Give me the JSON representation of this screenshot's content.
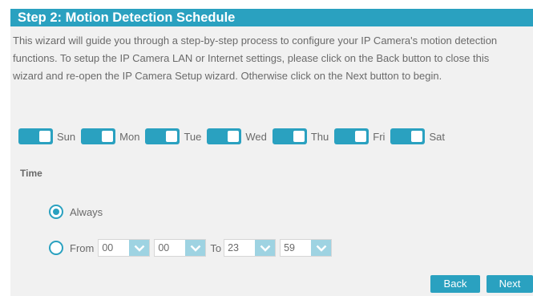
{
  "header": {
    "title": "Step 2: Motion Detection Schedule"
  },
  "intro": {
    "line1": "This wizard will guide you through a step-by-step process to configure your IP Camera's motion detection",
    "line2": "functions. To setup the IP Camera LAN or Internet settings, please click on the Back button to close this",
    "line3": "wizard and re-open the IP Camera Setup wizard. Otherwise click on the Next button to begin."
  },
  "days": [
    {
      "label": "Sun",
      "enabled": true
    },
    {
      "label": "Mon",
      "enabled": true
    },
    {
      "label": "Tue",
      "enabled": true
    },
    {
      "label": "Wed",
      "enabled": true
    },
    {
      "label": "Thu",
      "enabled": true
    },
    {
      "label": "Fri",
      "enabled": true
    },
    {
      "label": "Sat",
      "enabled": true
    }
  ],
  "time": {
    "label": "Time",
    "always_label": "Always",
    "always_selected": true,
    "from_label": "From",
    "to_label": "To",
    "from_hour": "00",
    "from_minute": "00",
    "to_hour": "23",
    "to_minute": "59"
  },
  "buttons": {
    "back": "Back",
    "next": "Next"
  },
  "colors": {
    "accent": "#2aa1c0",
    "select_arrow_bg": "#9ed3e2",
    "panel_bg": "#f1f1f1",
    "text": "#6a6a6a"
  },
  "icons": {
    "select_arrow": "chevron-down-icon"
  }
}
